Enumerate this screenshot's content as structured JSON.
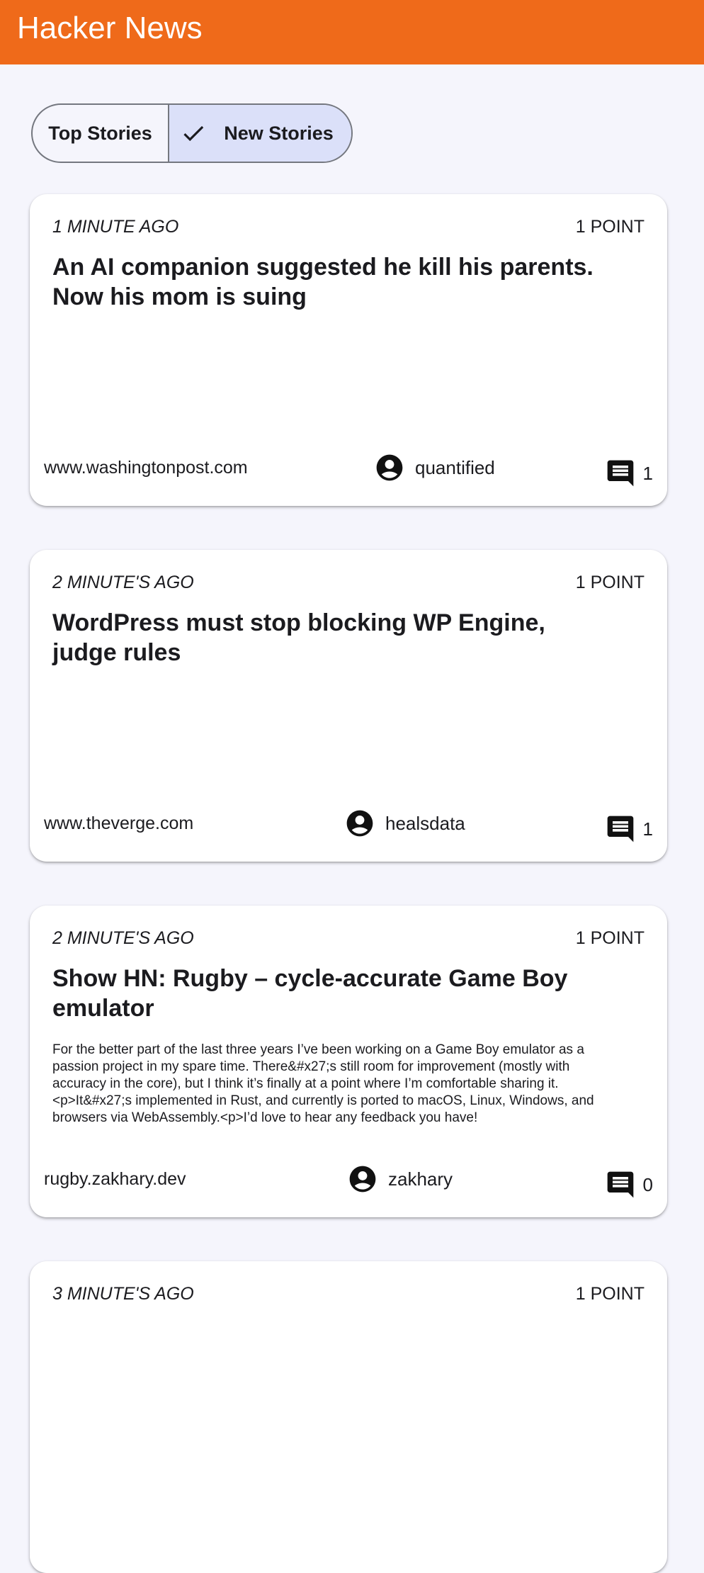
{
  "app": {
    "title": "Hacker News",
    "accent_color": "#ef6a1a"
  },
  "tabs": [
    {
      "label": "Top Stories",
      "selected": false
    },
    {
      "label": "New Stories",
      "selected": true,
      "icon": "check-icon"
    }
  ],
  "stories": [
    {
      "time": "1 minute ago",
      "points": "1 point",
      "title": "An AI companion suggested he kill his parents. Now his mom is suing",
      "text": "",
      "domain": "www.washingtonpost.com",
      "author": "quantified",
      "comments": "1"
    },
    {
      "time": "2 minute's ago",
      "points": "1 point",
      "title": "WordPress must stop blocking WP Engine, judge rules",
      "text": "",
      "domain": "www.theverge.com",
      "author": "healsdata",
      "comments": "1"
    },
    {
      "time": "2 minute's ago",
      "points": "1 point",
      "title": "Show HN: Rugby – cycle-accurate Game Boy emulator",
      "text": "For the better part of the last three years I’ve been working on a Game Boy emulator as a passion project in my spare time. There&#x27;s still room for improvement (mostly with accuracy in the core), but I think it’s finally at a point where I’m comfortable sharing it.<p>It&#x27;s implemented in Rust, and currently is ported to macOS, Linux, Windows, and browsers via WebAssembly.<p>I’d love to hear any feedback you have!",
      "domain": "rugby.zakhary.dev",
      "author": "zakhary",
      "comments": "0"
    },
    {
      "time": "3 minute's ago",
      "points": "1 point"
    }
  ]
}
